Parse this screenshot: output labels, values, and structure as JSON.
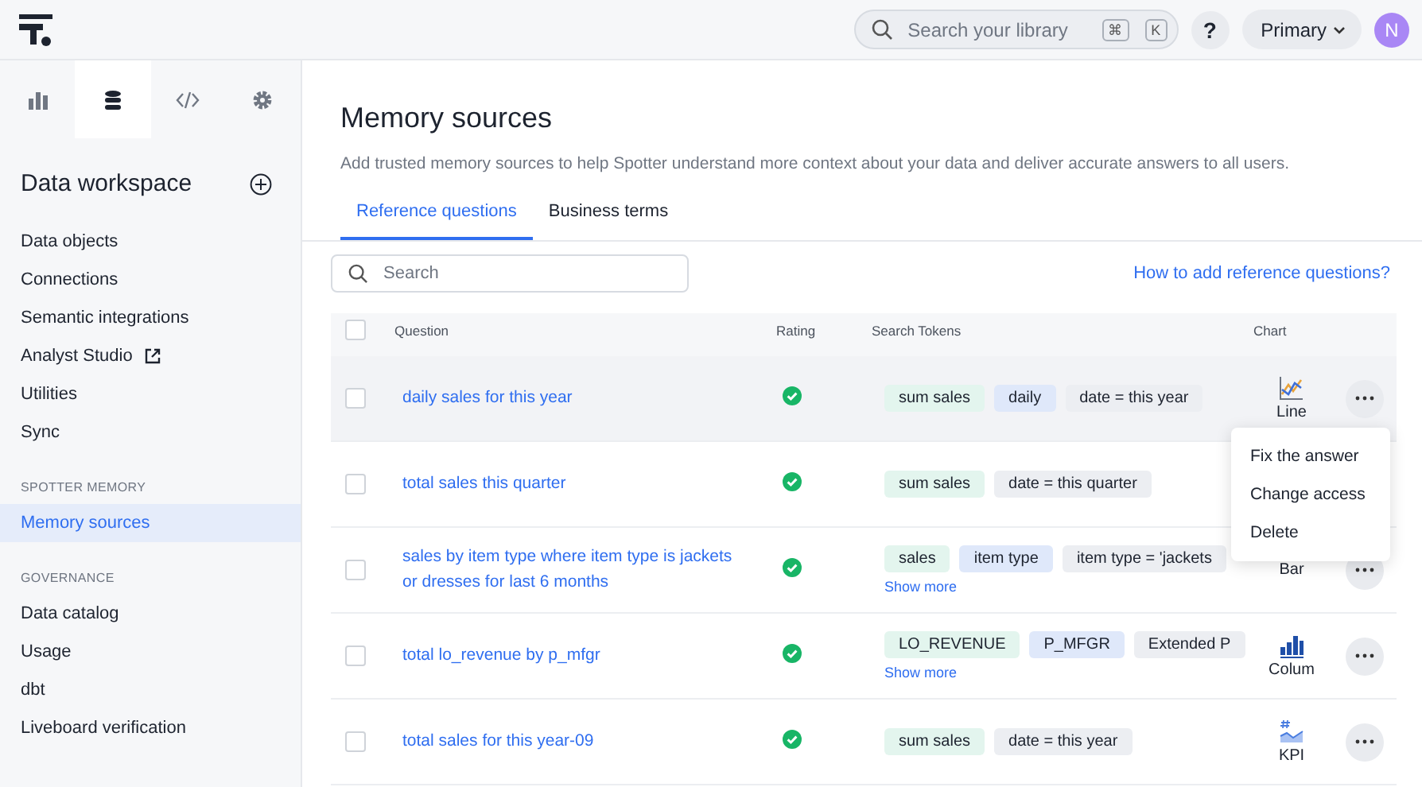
{
  "topbar": {
    "search": {
      "placeholder": "Search your library",
      "keys": [
        "⌘",
        "K"
      ]
    },
    "help": "?",
    "org": "Primary",
    "avatar": "N"
  },
  "sidebar": {
    "tabs": [
      {
        "kind": "chart",
        "selected": false
      },
      {
        "kind": "data",
        "selected": true
      },
      {
        "kind": "code",
        "selected": false
      },
      {
        "kind": "settings",
        "selected": false
      }
    ],
    "title": "Data workspace",
    "groups": [
      {
        "items": [
          {
            "label": "Data objects",
            "selected": false,
            "external": false
          },
          {
            "label": "Connections",
            "selected": false,
            "external": false
          },
          {
            "label": "Semantic integrations",
            "selected": false,
            "external": false
          },
          {
            "label": "Analyst Studio",
            "selected": false,
            "external": true
          },
          {
            "label": "Utilities",
            "selected": false,
            "external": false
          },
          {
            "label": "Sync",
            "selected": false,
            "external": false
          }
        ]
      },
      {
        "heading": "SPOTTER MEMORY",
        "items": [
          {
            "label": "Memory sources",
            "selected": true,
            "external": false
          }
        ]
      },
      {
        "heading": "GOVERNANCE",
        "items": [
          {
            "label": "Data catalog",
            "selected": false,
            "external": false
          },
          {
            "label": "Usage",
            "selected": false,
            "external": false
          },
          {
            "label": "dbt",
            "selected": false,
            "external": false
          },
          {
            "label": "Liveboard verification",
            "selected": false,
            "external": false
          }
        ]
      }
    ]
  },
  "page": {
    "title": "Memory sources",
    "description": "Add trusted memory sources to help Spotter understand more context about your data and deliver accurate answers to all users.",
    "tabs": [
      {
        "label": "Reference questions",
        "selected": true
      },
      {
        "label": "Business terms",
        "selected": false
      }
    ],
    "search": {
      "placeholder": "Search"
    },
    "help_link": "How to add reference questions?"
  },
  "table": {
    "columns": [
      "Question",
      "Rating",
      "Search Tokens",
      "Chart"
    ],
    "header_checked": false,
    "rows": [
      {
        "question": "daily sales for this year",
        "checked": false,
        "highlighted": true,
        "rated": true,
        "tokens": [
          {
            "kind": "measure",
            "text": "sum sales"
          },
          {
            "kind": "attribute",
            "text": "daily"
          },
          {
            "kind": "filter",
            "text": "date = this year"
          }
        ],
        "chart": {
          "kind": "line",
          "label": "Line"
        },
        "more_button": true
      },
      {
        "question": "total sales this quarter",
        "checked": false,
        "highlighted": false,
        "rated": true,
        "tokens": [
          {
            "kind": "measure",
            "text": "sum sales"
          },
          {
            "kind": "filter",
            "text": "date = this quarter"
          }
        ],
        "more_button": false
      },
      {
        "question": "sales by item type where item type is jackets or dresses for last 6 months",
        "checked": false,
        "highlighted": false,
        "rated": true,
        "tokens": [
          {
            "kind": "measure",
            "text": "sales"
          },
          {
            "kind": "attribute",
            "text": "item type"
          },
          {
            "kind": "filter",
            "text": "item type = 'jackets"
          }
        ],
        "show_more": "Show more",
        "chart": {
          "kind": "bar",
          "label": "Bar"
        },
        "more_button": true
      },
      {
        "question": "total lo_revenue by p_mfgr",
        "checked": false,
        "highlighted": false,
        "rated": true,
        "tokens": [
          {
            "kind": "measure",
            "text": "LO_REVENUE"
          },
          {
            "kind": "attribute",
            "text": "P_MFGR"
          },
          {
            "kind": "filter",
            "text": "Extended P"
          }
        ],
        "show_more": "Show more",
        "chart": {
          "kind": "column",
          "label": "Colum"
        },
        "more_button": true
      },
      {
        "question": "total sales for this year-09",
        "checked": false,
        "highlighted": false,
        "rated": true,
        "tokens": [
          {
            "kind": "measure",
            "text": "sum sales"
          },
          {
            "kind": "filter",
            "text": "date = this year"
          }
        ],
        "chart": {
          "kind": "kpi",
          "label": "KPI"
        },
        "more_button": true
      }
    ]
  },
  "menu": {
    "items": [
      "Fix the answer",
      "Change access",
      "Delete"
    ]
  }
}
